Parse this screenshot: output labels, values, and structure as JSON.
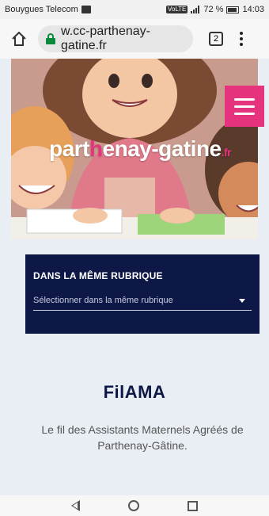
{
  "status_bar": {
    "carrier": "Bouygues Telecom",
    "network": "VoLTE",
    "battery": "72 %",
    "time": "14:03"
  },
  "browser": {
    "url": "w.cc-parthenay-gatine.fr",
    "tab_count": "2"
  },
  "hero": {
    "logo_part1": "part",
    "logo_part2": "h",
    "logo_part3": "enay-gatine",
    "logo_tld": ".fr"
  },
  "rubrique": {
    "title": "DANS LA MÊME RUBRIQUE",
    "select_placeholder": "Sélectionner dans la même rubrique"
  },
  "section": {
    "title": "FilAMA",
    "subtitle": "Le fil des Assistants Maternels Agréés de Parthenay-Gâtine."
  },
  "colors": {
    "navy": "#0d1846",
    "pink": "#e5347d"
  }
}
